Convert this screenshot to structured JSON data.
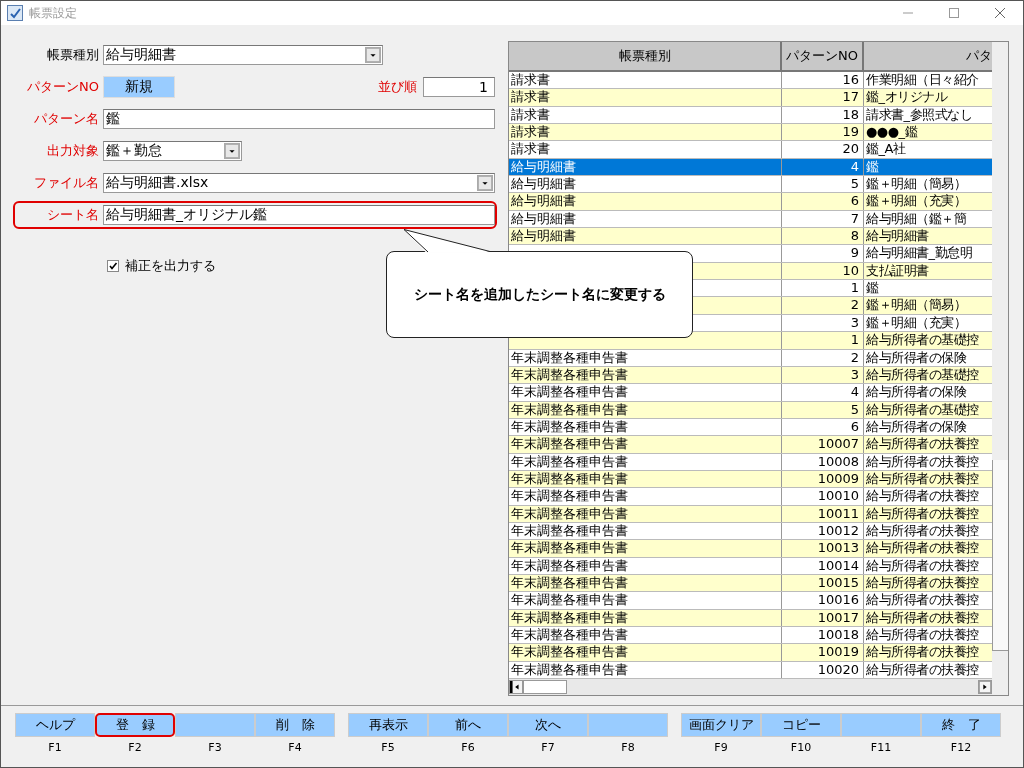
{
  "window": {
    "title": "帳票設定"
  },
  "form": {
    "fields": [
      {
        "kind": "combo",
        "label": "帳票種別",
        "required": false,
        "value": "給与明細書"
      },
      {
        "kind": "badge",
        "label": "パターンNO",
        "required": true,
        "value": "新規",
        "extra": {
          "label": "並び順",
          "required": true,
          "value": "1"
        }
      },
      {
        "kind": "text",
        "label": "パターン名",
        "required": true,
        "value": "鑑"
      },
      {
        "kind": "combo",
        "label": "出力対象",
        "required": true,
        "value": "鑑＋勤怠"
      },
      {
        "kind": "combo",
        "label": "ファイル名",
        "required": true,
        "value": "給与明細書.xlsx"
      },
      {
        "kind": "text",
        "label": "シート名",
        "required": true,
        "value": "給与明細書_オリジナル鑑",
        "highlighted": true
      }
    ],
    "checkbox": {
      "label": "補正を出力する",
      "checked": true
    }
  },
  "callout": {
    "text": "シート名を追加したシート名に変更する"
  },
  "table": {
    "columns": [
      "帳票種別",
      "パターンNO",
      "パタ"
    ],
    "rows": [
      {
        "type": "請求書",
        "no": "16",
        "name": "作業明細（日々紹介",
        "selected": false
      },
      {
        "type": "請求書",
        "no": "17",
        "name": "鑑_オリジナル",
        "selected": false
      },
      {
        "type": "請求書",
        "no": "18",
        "name": "請求書_参照式なし",
        "selected": false
      },
      {
        "type": "請求書",
        "no": "19",
        "name": "●●●_鑑",
        "selected": false
      },
      {
        "type": "請求書",
        "no": "20",
        "name": "鑑_A社",
        "selected": false
      },
      {
        "type": "給与明細書",
        "no": "4",
        "name": "鑑",
        "selected": true
      },
      {
        "type": "給与明細書",
        "no": "5",
        "name": "鑑＋明細（簡易）",
        "selected": false
      },
      {
        "type": "給与明細書",
        "no": "6",
        "name": "鑑＋明細（充実）",
        "selected": false
      },
      {
        "type": "給与明細書",
        "no": "7",
        "name": "給与明細（鑑＋簡",
        "selected": false
      },
      {
        "type": "給与明細書",
        "no": "8",
        "name": "給与明細書",
        "selected": false
      },
      {
        "no": "9",
        "name": "給与明細書_勤怠明",
        "selected": false
      },
      {
        "no": "10",
        "name": "支払証明書",
        "selected": false
      },
      {
        "no": "1",
        "name": "鑑",
        "selected": false
      },
      {
        "no": "2",
        "name": "鑑＋明細（簡易）",
        "selected": false
      },
      {
        "no": "3",
        "name": "鑑＋明細（充実）",
        "selected": false
      },
      {
        "no": "1",
        "name": "給与所得者の基礎控",
        "selected": false
      },
      {
        "type": "年末調整各種申告書",
        "no": "2",
        "name": "給与所得者の保険",
        "selected": false
      },
      {
        "type": "年末調整各種申告書",
        "no": "3",
        "name": "給与所得者の基礎控",
        "selected": false
      },
      {
        "type": "年末調整各種申告書",
        "no": "4",
        "name": "給与所得者の保険",
        "selected": false
      },
      {
        "type": "年末調整各種申告書",
        "no": "5",
        "name": "給与所得者の基礎控",
        "selected": false
      },
      {
        "type": "年末調整各種申告書",
        "no": "6",
        "name": "給与所得者の保険",
        "selected": false
      },
      {
        "type": "年末調整各種申告書",
        "no": "10007",
        "name": "給与所得者の扶養控",
        "selected": false
      },
      {
        "type": "年末調整各種申告書",
        "no": "10008",
        "name": "給与所得者の扶養控",
        "selected": false
      },
      {
        "type": "年末調整各種申告書",
        "no": "10009",
        "name": "給与所得者の扶養控",
        "selected": false
      },
      {
        "type": "年末調整各種申告書",
        "no": "10010",
        "name": "給与所得者の扶養控",
        "selected": false
      },
      {
        "type": "年末調整各種申告書",
        "no": "10011",
        "name": "給与所得者の扶養控",
        "selected": false
      },
      {
        "type": "年末調整各種申告書",
        "no": "10012",
        "name": "給与所得者の扶養控",
        "selected": false
      },
      {
        "type": "年末調整各種申告書",
        "no": "10013",
        "name": "給与所得者の扶養控",
        "selected": false
      },
      {
        "type": "年末調整各種申告書",
        "no": "10014",
        "name": "給与所得者の扶養控",
        "selected": false
      },
      {
        "type": "年末調整各種申告書",
        "no": "10015",
        "name": "給与所得者の扶養控",
        "selected": false
      },
      {
        "type": "年末調整各種申告書",
        "no": "10016",
        "name": "給与所得者の扶養控",
        "selected": false
      },
      {
        "type": "年末調整各種申告書",
        "no": "10017",
        "name": "給与所得者の扶養控",
        "selected": false
      },
      {
        "type": "年末調整各種申告書",
        "no": "10018",
        "name": "給与所得者の扶養控",
        "selected": false
      },
      {
        "type": "年末調整各種申告書",
        "no": "10019",
        "name": "給与所得者の扶養控",
        "selected": false
      },
      {
        "type": "年末調整各種申告書",
        "no": "10020",
        "name": "給与所得者の扶養控",
        "selected": false
      }
    ]
  },
  "function_keys": [
    {
      "label": "ヘルプ",
      "key": "F1",
      "highlighted": false
    },
    {
      "label": "登　録",
      "key": "F2",
      "highlighted": true
    },
    {
      "key": "F3",
      "highlighted": false
    },
    {
      "label": "削　除",
      "key": "F4",
      "highlighted": false
    },
    {
      "label": "再表示",
      "key": "F5",
      "highlighted": false
    },
    {
      "label": "前へ",
      "key": "F6",
      "highlighted": false
    },
    {
      "label": "次へ",
      "key": "F7",
      "highlighted": false
    },
    {
      "key": "F8",
      "highlighted": false
    },
    {
      "label": "画面クリア",
      "key": "F9",
      "highlighted": false
    },
    {
      "label": "コピー",
      "key": "F10",
      "highlighted": false
    },
    {
      "key": "F11",
      "highlighted": false
    },
    {
      "label": "終　了",
      "key": "F12",
      "highlighted": false
    }
  ]
}
